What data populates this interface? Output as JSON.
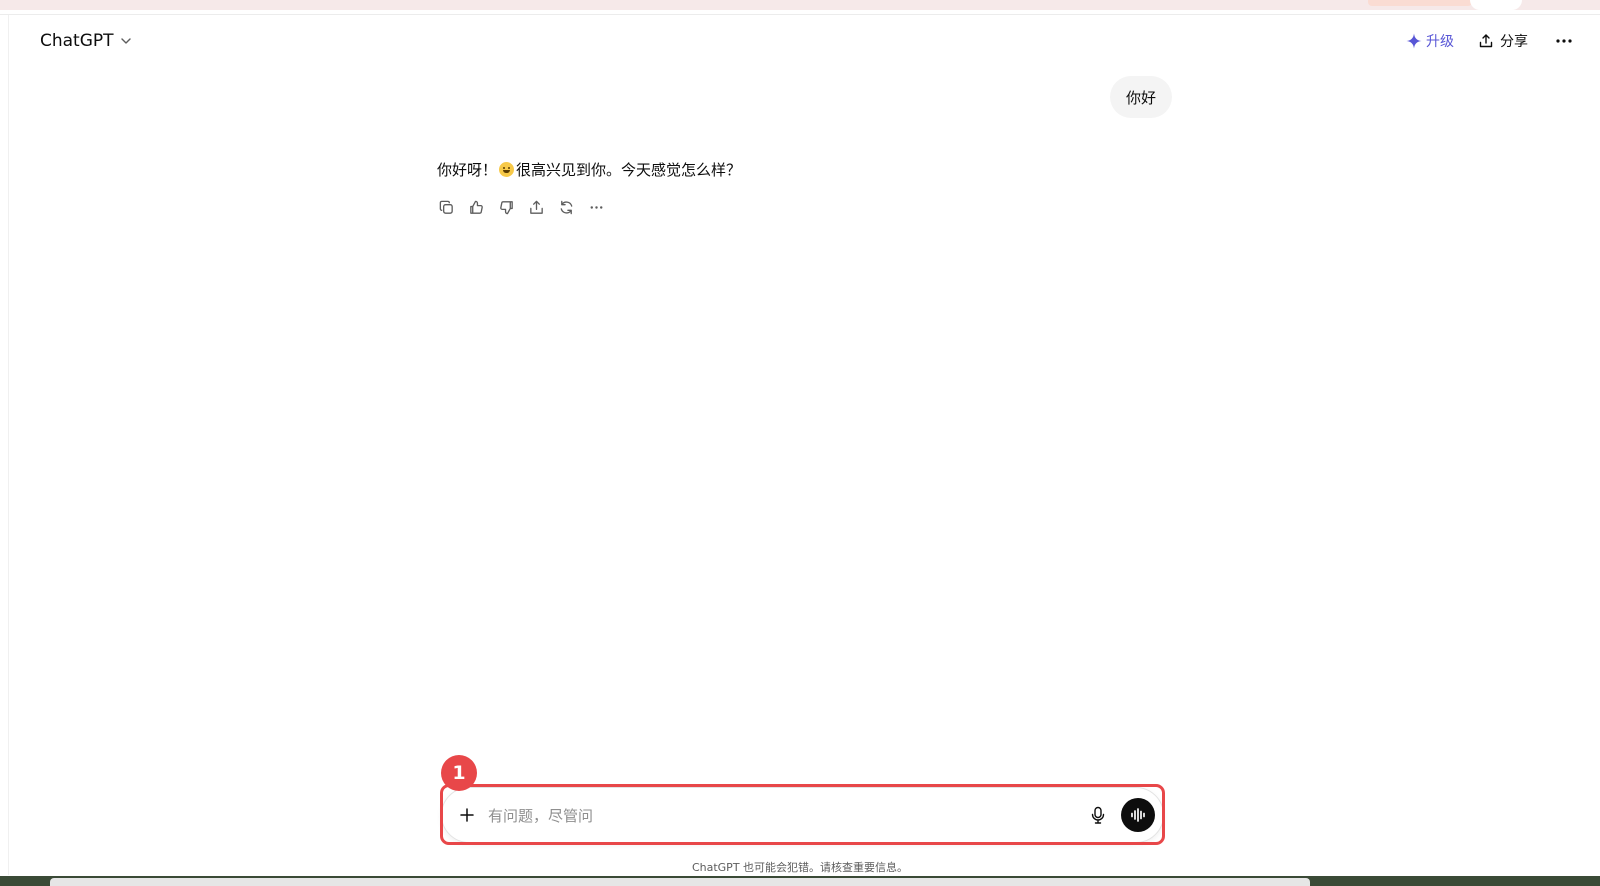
{
  "header": {
    "model_name": "ChatGPT",
    "upgrade_label": "升级",
    "share_label": "分享"
  },
  "conversation": {
    "user_message": "你好",
    "assistant_message_before": "你好呀！",
    "assistant_message_after": "很高兴见到你。今天感觉怎么样？",
    "assistant_actions": [
      "copy-icon",
      "thumbs-up-icon",
      "thumbs-down-icon",
      "share-icon",
      "regenerate-icon",
      "more-horizontal-icon"
    ]
  },
  "composer": {
    "placeholder": "有问题，尽管问",
    "value": ""
  },
  "annotation": {
    "step_number": "1"
  },
  "footer": {
    "disclaimer": "ChatGPT 也可能会犯错。请核查重要信息。"
  },
  "colors": {
    "accent": "#5856d6",
    "highlight": "#e84749",
    "bubble": "#f4f4f4"
  }
}
